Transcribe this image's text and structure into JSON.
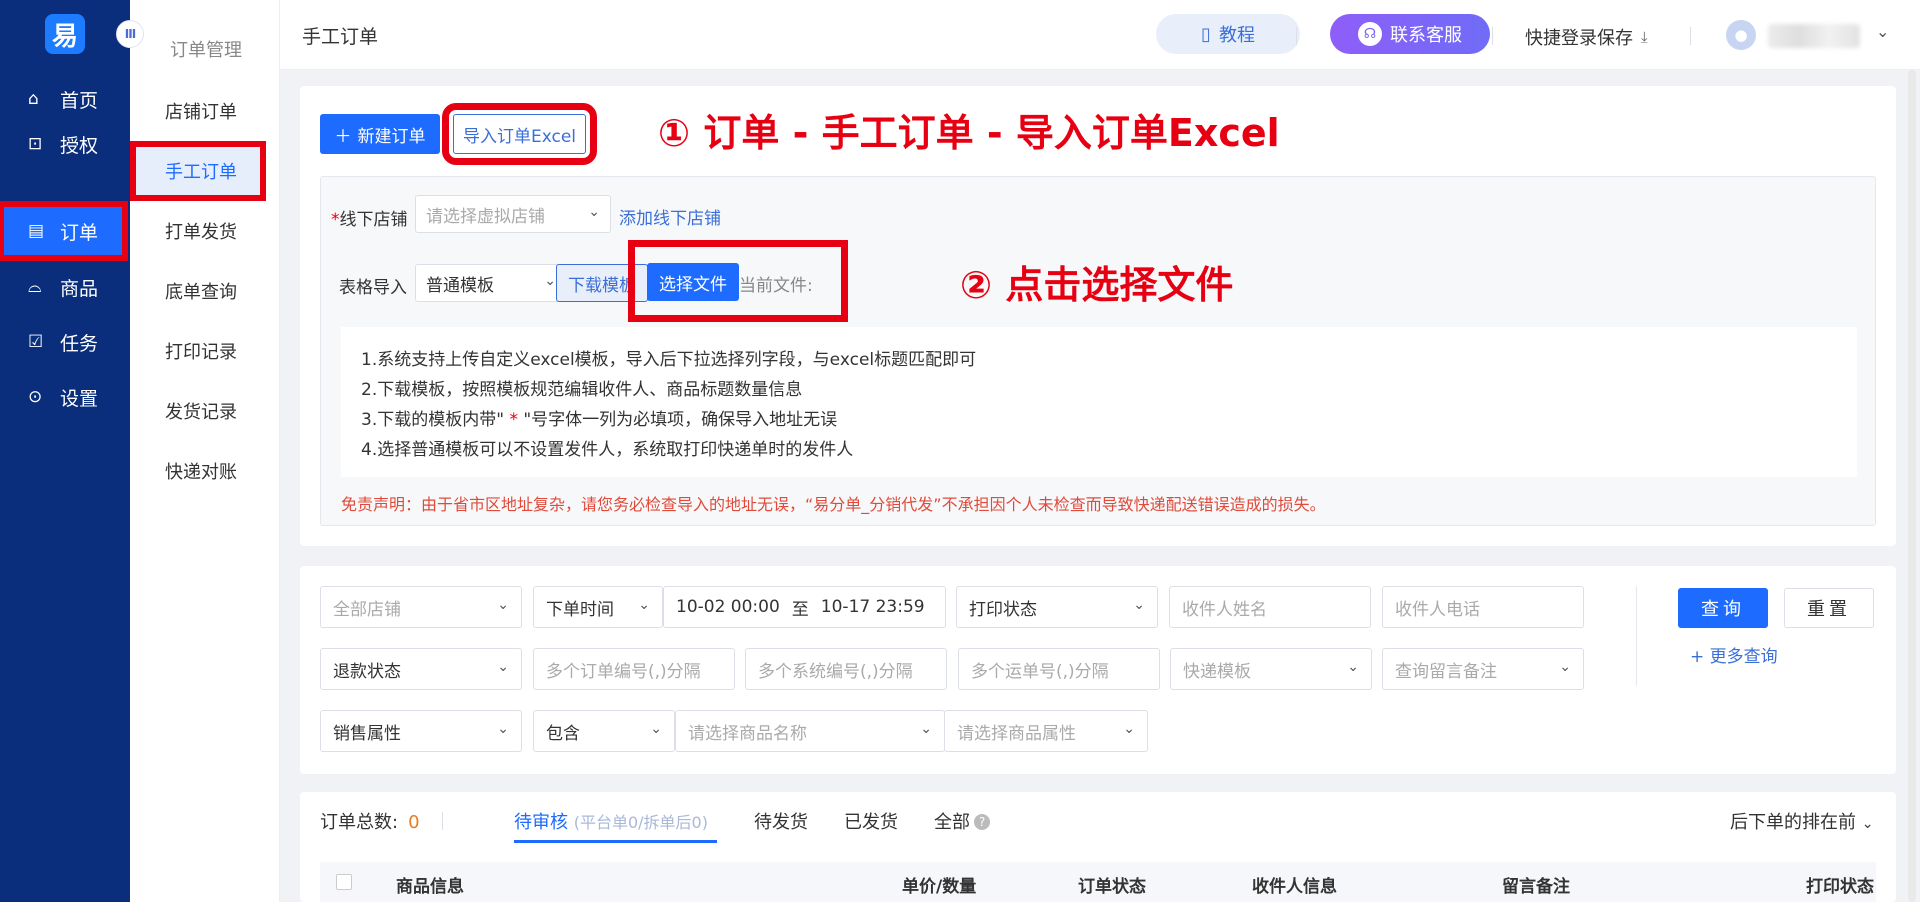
{
  "sidebar": {
    "logo": "易",
    "collapse_glyph": "III",
    "items": [
      {
        "label": "首页",
        "icon": "home-icon",
        "glyph": "⌂"
      },
      {
        "label": "授权",
        "icon": "authorize-icon",
        "glyph": "⊡"
      },
      {
        "label": "订单",
        "icon": "order-icon",
        "glyph": "▤"
      },
      {
        "label": "商品",
        "icon": "goods-icon",
        "glyph": "⌓"
      },
      {
        "label": "任务",
        "icon": "task-icon",
        "glyph": "☑"
      },
      {
        "label": "设置",
        "icon": "settings-icon",
        "glyph": "⊙"
      }
    ],
    "active_index": 2
  },
  "subnav": {
    "title": "订单管理",
    "items": [
      "店铺订单",
      "手工订单",
      "打单发货",
      "底单查询",
      "打印记录",
      "发货记录",
      "快递对账"
    ],
    "active_index": 1
  },
  "header": {
    "title": "手工订单",
    "tutorial": "教程",
    "service": "联系客服",
    "quick_login": "快捷登录保存"
  },
  "toolbar": {
    "new_order": "新建订单",
    "import_excel": "导入订单Excel"
  },
  "annotations": {
    "step1": "① 订单 - 手工订单 - 导入订单Excel",
    "step2": "② 点击选择文件"
  },
  "import_form": {
    "store_label": "线下店铺",
    "required_mark": "*",
    "store_placeholder": "请选择虚拟店铺",
    "add_store_link": "添加线下店铺",
    "template_label": "表格导入",
    "template_value": "普通模板",
    "download_template": "下载模板",
    "choose_file": "选择文件",
    "current_file": "当前文件:"
  },
  "notes": [
    "1.系统支持上传自定义excel模板，导入后下拉选择列字段，与excel标题匹配即可",
    "2.下载模板，按照模板规范编辑收件人、商品标题数量信息",
    "3.下载的模板内带\"",
    "\"号字体一列为必填项，确保导入地址无误",
    "4.选择普通模板可以不设置发件人，系统取打印快递单时的发件人"
  ],
  "disclaimer": "免责声明：由于省市区地址复杂，请您务必检查导入的地址无误，“易分单_分销代发”不承担因个人未检查而导致快递配送错误造成的损失。",
  "filters": {
    "all_stores": "全部店铺",
    "order_time": "下单时间",
    "date_from": "10-02 00:00",
    "date_sep": "至",
    "date_to": "10-17 23:59",
    "print_status": "打印状态",
    "receiver_name": "收件人姓名",
    "receiver_phone": "收件人电话",
    "refund_status": "退款状态",
    "order_nos": "多个订单编号(,)分隔",
    "system_nos": "多个系统编号(,)分隔",
    "waybill_nos": "多个运单号(,)分隔",
    "express_template": "快递模板",
    "remark_query": "查询留言备注",
    "sale_attr": "销售属性",
    "contains": "包含",
    "goods_name": "请选择商品名称",
    "goods_attr": "请选择商品属性",
    "query": "查询",
    "reset": "重置",
    "more": "+ 更多查询"
  },
  "orders": {
    "total_label": "订单总数:",
    "total": "0",
    "tabs": [
      "待审核",
      "待发货",
      "已发货",
      "全部"
    ],
    "pending_sub": "(平台单0/拆单后0)",
    "sort": "后下单的排在前",
    "columns": [
      "商品信息",
      "单价/数量",
      "订单状态",
      "收件人信息",
      "留言备注",
      "打印状态"
    ]
  },
  "colors": {
    "primary": "#1d6bff",
    "sidebar": "#0a2d7c",
    "annotation": "#e60012"
  }
}
